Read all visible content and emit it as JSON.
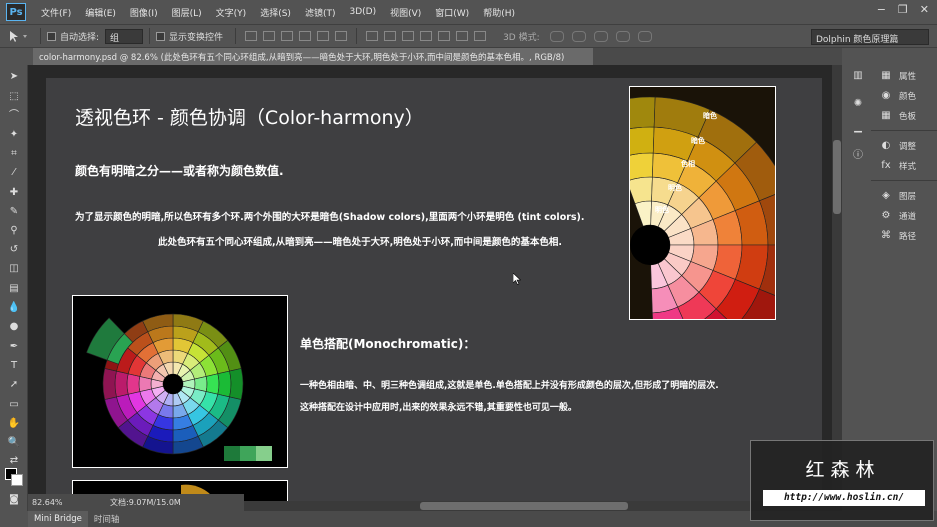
{
  "app": {
    "logo": "Ps"
  },
  "menubar": {
    "items": [
      "文件(F)",
      "编辑(E)",
      "图像(I)",
      "图层(L)",
      "文字(Y)",
      "选择(S)",
      "滤镜(T)",
      "3D(D)",
      "视图(V)",
      "窗口(W)",
      "帮助(H)"
    ],
    "window_controls": [
      "−",
      "❐",
      "✕"
    ]
  },
  "optionsbar": {
    "auto_select_label": "自动选择:",
    "auto_select_value": "组",
    "show_transform_label": "显示变换控件",
    "mode3d_label": "3D 模式:",
    "workspace": "Dolphin 颜色原理篇"
  },
  "document_tab": {
    "title": "color-harmony.psd @ 82.6% (此处色环有五个同心环组成,从暗到亮——暗色处于大环,明色处于小环,而中间是颜色的基本色相。, RGB/8)"
  },
  "document": {
    "title": "透视色环 - 颜色协调（Color-harmony）",
    "subtitle": "颜色有明暗之分——或者称为颜色数值.",
    "para1": "为了显示颜色的明暗,所以色环有多个环.两个外围的大环是暗色(Shadow colors),里面两个小环是明色 (tint colors).",
    "para2": "此处色环有五个同心环组成,从暗到亮——暗色处于大环,明色处于小环,而中间是颜色的基本色相.",
    "tint_labels": [
      "暗色",
      "暗色",
      "色相",
      "明色",
      "明色"
    ],
    "mono_heading": "单色搭配(Monochromatic)：",
    "mono_text1": "一种色相由暗、中、明三种色调组成,这就是单色.单色搭配上并没有形成颜色的层次,但形成了明暗的层次.",
    "mono_text2": "这种搭配在设计中应用时,出来的效果永远不错,其重要性也可见一般。",
    "swatch_colors": [
      "#1e7a3a",
      "#3fa55a",
      "#86cf8c"
    ]
  },
  "status": {
    "zoom": "82.64%",
    "doc_size": "文档:9.07M/15.0M"
  },
  "bottom_panel": {
    "tabs": [
      "Mini Bridge",
      "时间轴"
    ]
  },
  "right_panels": {
    "group1": [
      "属性",
      "颜色",
      "色板"
    ],
    "group2": [
      "调整",
      "样式"
    ],
    "group3": [
      "图层",
      "通道",
      "路径"
    ]
  },
  "watermark": {
    "title": "红森林",
    "url": "http://www.hoslin.cn/"
  },
  "colors": {
    "accent": "#5ab4f0",
    "canvas_bg": "#282828",
    "doc_bg": "#3f3f41"
  }
}
